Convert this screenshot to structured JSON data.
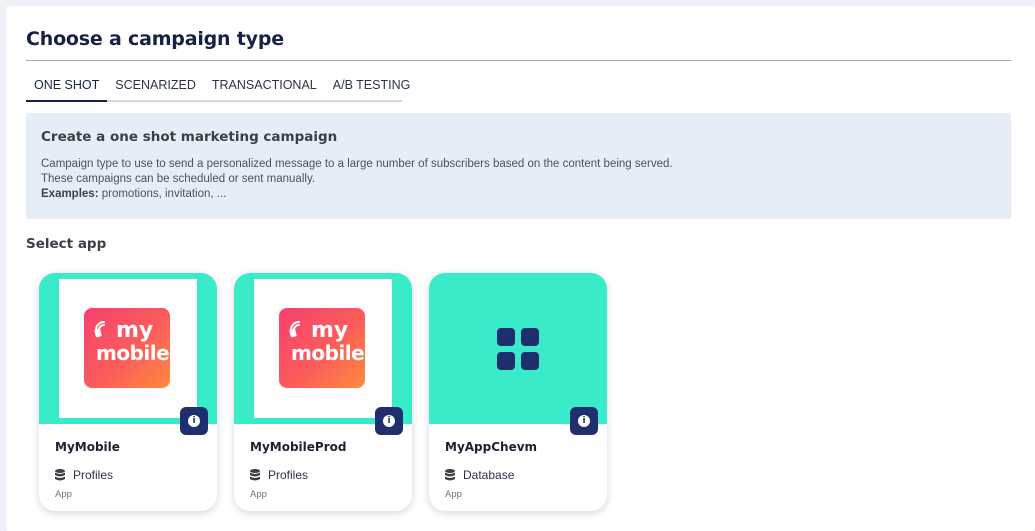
{
  "header": {
    "title": "Choose a campaign type"
  },
  "tabs": [
    {
      "label": "ONE SHOT",
      "active": true
    },
    {
      "label": "SCENARIZED",
      "active": false
    },
    {
      "label": "TRANSACTIONAL",
      "active": false
    },
    {
      "label": "A/B TESTING",
      "active": false
    }
  ],
  "description": {
    "title": "Create a one shot marketing campaign",
    "line1": "Campaign type to use to send a personalized message to a large number of subscribers based on the content being served.",
    "line2": "These campaigns can be scheduled or sent manually.",
    "examples_label": "Examples:",
    "examples_text": " promotions, invitation, ..."
  },
  "select_app": {
    "title": "Select app",
    "apps": [
      {
        "name": "MyMobile",
        "source": "Profiles",
        "kind": "App",
        "image": "mymobile-logo",
        "logo_top": "my",
        "logo_bottom": "mobile"
      },
      {
        "name": "MyMobileProd",
        "source": "Profiles",
        "kind": "App",
        "image": "mymobile-logo",
        "logo_top": "my",
        "logo_bottom": "mobile"
      },
      {
        "name": "MyAppChevm",
        "source": "Database",
        "kind": "App",
        "image": "grid-icon"
      }
    ]
  },
  "colors": {
    "card_accent": "#3aebc9",
    "primary_dark": "#1f2f6e",
    "title": "#152244",
    "info_bg": "#e6edf6"
  },
  "icons": {
    "info": "info-icon",
    "source": "database-icon",
    "app_placeholder": "grid-icon"
  }
}
